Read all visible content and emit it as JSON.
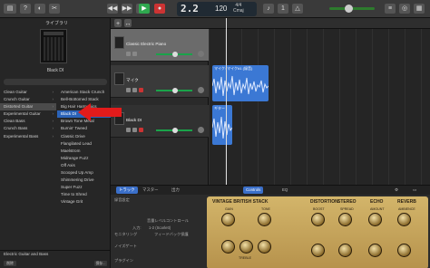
{
  "toolbar": {
    "lcd_bar": "2.2",
    "lcd_tempo": "120",
    "lcd_sig_top": "4/4",
    "lcd_sig_bottom": "Cmaj"
  },
  "library": {
    "title": "ライブラリ",
    "preset_name": "Black DI",
    "categories": [
      "Clean Guitar",
      "Crunch Guitar",
      "Distorted Guitar",
      "Experimental Guitar",
      "Clean Bass",
      "Crunch Bass",
      "Experimental Bass"
    ],
    "selected_category_index": 2,
    "presets": [
      "American Stack Crunch",
      "Bell-Bottomed Stack",
      "Big Hair Harmonics",
      "Black DI",
      "Brown Tone Metal",
      "Burnin' Tweed",
      "Classic Drive",
      "Flangilated Lead",
      "Maelstrom",
      "Midrange Fuzz",
      "Off Axis",
      "Scooped Up Amp",
      "Shimmering Drive",
      "Super Fuzz",
      "Time to Shred",
      "Vintage Grit"
    ],
    "selected_preset_index": 3,
    "footer_category": "Electric Guitar and Bass",
    "footer_delete": "削除",
    "footer_save": "保存..."
  },
  "tracks": [
    {
      "name": "Classic Electric Piano"
    },
    {
      "name": "マイク"
    },
    {
      "name": "Black DI"
    }
  ],
  "regions": {
    "audio1": "マイク: マイク#1 (録音)",
    "audio2": "ギター"
  },
  "smart": {
    "tab_track": "トラック",
    "tab_master": "マスター",
    "tab_output": "出力",
    "tab_controls": "Controls",
    "tab_eq": "EQ",
    "settings_title": "録音設定",
    "input_label": "入力:",
    "input_value": "1-2 (Scarlett)",
    "monitoring_label": "モニタリング",
    "noise_gate_label": "ノイズゲート",
    "plugins_label": "プラグイン",
    "monitor_sub": "音量レベルコントロール",
    "feedback_label": "フィードバック保護",
    "amp_title_1": "VINTAGE BRITISH STACK",
    "amp_title_2": "DISTORTION",
    "amp_title_3": "STEREO",
    "amp_title_4": "ECHO",
    "amp_title_5": "REVERB",
    "knob_gain": "GAIN",
    "knob_tone": "TONE",
    "knob_treble": "TREBLE",
    "knob_boost": "BOOST",
    "knob_spread": "SPREAD",
    "knob_amount": "AMOUNT",
    "knob_ambience": "AMBIENCE"
  },
  "colors": {
    "accent": "#3b78d4",
    "play": "#2fa84f",
    "arrow": "#e21b1b"
  }
}
